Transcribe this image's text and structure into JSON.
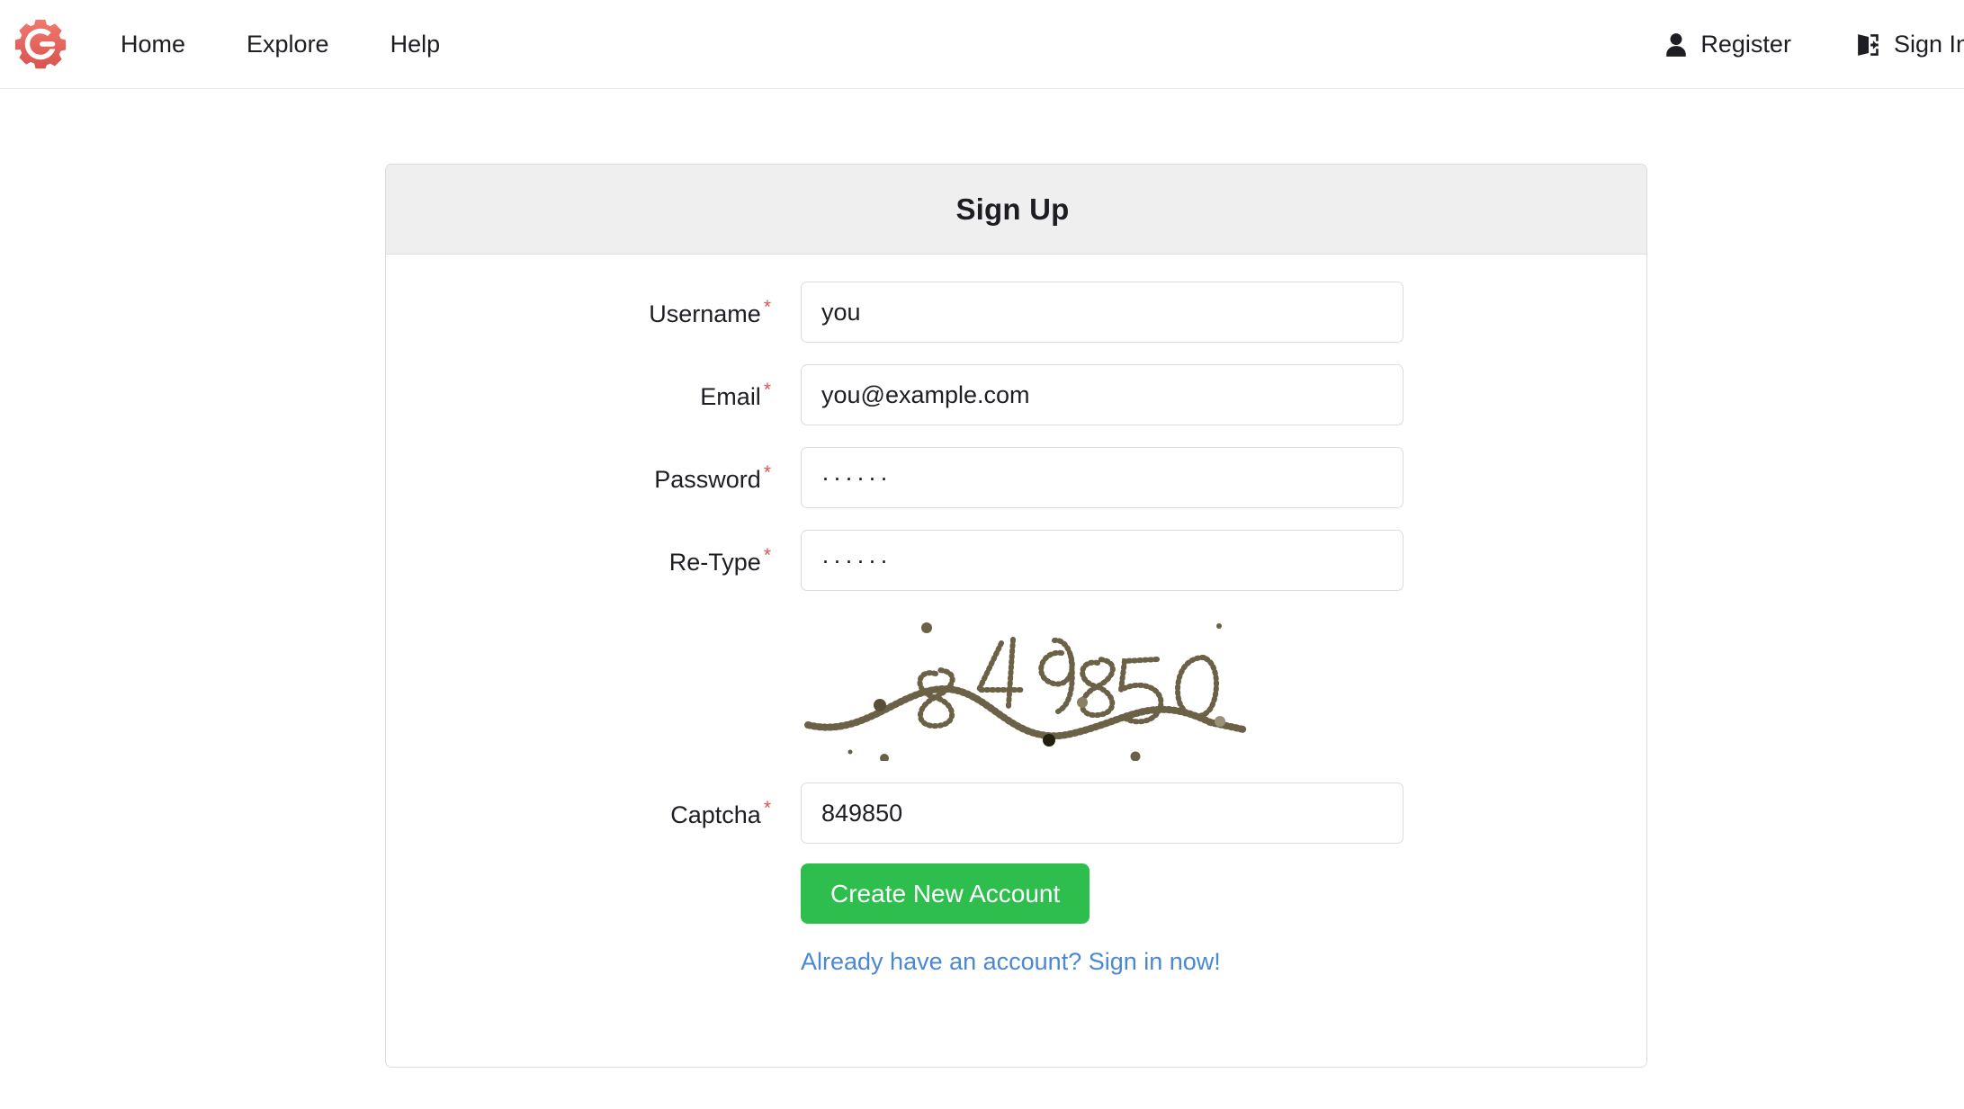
{
  "navbar": {
    "brand": {
      "icon": "gear-logo-icon",
      "color": "#e8645a"
    },
    "links": [
      {
        "label": "Home",
        "name": "nav-link-home"
      },
      {
        "label": "Explore",
        "name": "nav-link-explore"
      },
      {
        "label": "Help",
        "name": "nav-link-help"
      }
    ],
    "right": [
      {
        "label": "Register",
        "icon": "user-icon",
        "name": "nav-link-register"
      },
      {
        "label": "Sign In",
        "icon": "sign-in-icon",
        "name": "nav-link-sign-in"
      }
    ]
  },
  "card": {
    "title": "Sign Up",
    "fields": [
      {
        "label": "Username",
        "required_marker": "*",
        "value": "you",
        "placeholder": "Username",
        "type": "text",
        "name": "username"
      },
      {
        "label": "Email",
        "required_marker": "*",
        "value": "you@example.com",
        "placeholder": "Email",
        "type": "text",
        "name": "email"
      },
      {
        "label": "Password",
        "required_marker": "*",
        "value": "······",
        "placeholder": "Password",
        "type": "password",
        "name": "password"
      },
      {
        "label": "Re-Type",
        "required_marker": "*",
        "value": "······",
        "placeholder": "Re-Type",
        "type": "password",
        "name": "retype"
      }
    ],
    "captcha": {
      "image_text": "849850",
      "image_color": "#6b6147",
      "label": "Captcha",
      "required_marker": "*",
      "value": "849850",
      "placeholder": "Captcha"
    },
    "submit_label": "Create New Account",
    "submit_color": "#2dbe4e",
    "signin_link": "Already have an account? Sign in now!",
    "signin_link_color": "#4b88d2"
  }
}
